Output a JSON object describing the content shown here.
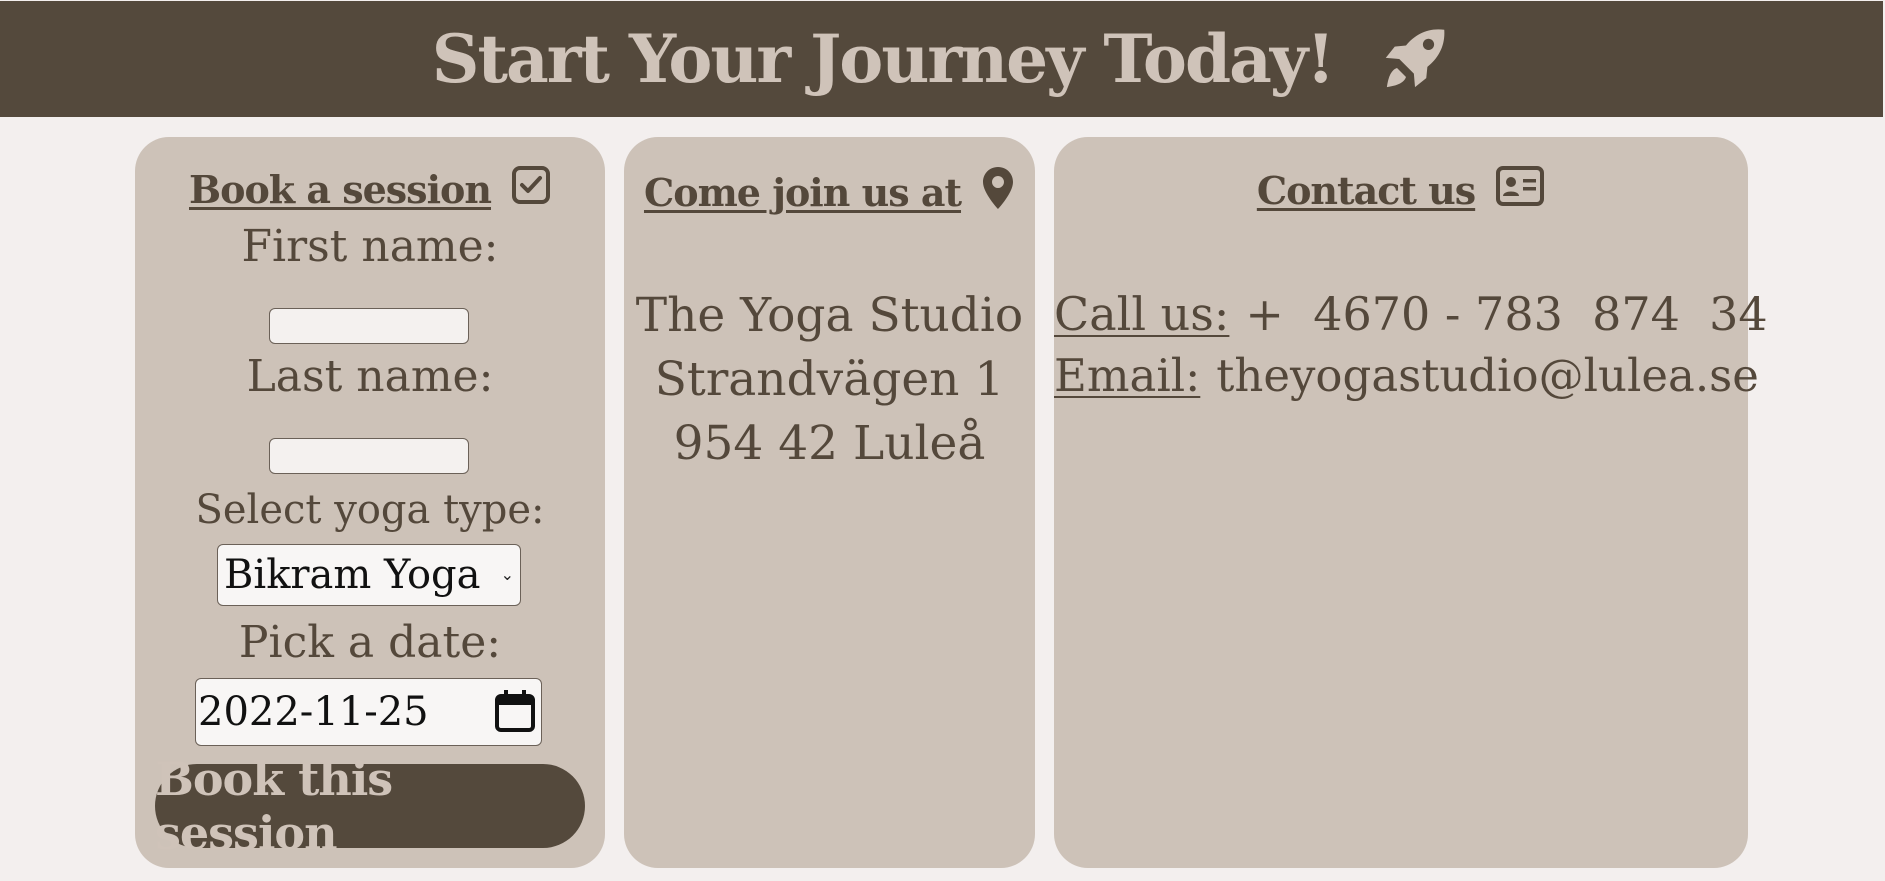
{
  "banner": {
    "title": "Start Your Journey Today!",
    "icon": "rocket-icon",
    "background": "#54493c",
    "text_color": "#cfc3b9"
  },
  "booking": {
    "heading": "Book a session",
    "heading_icon": "checkbox-icon",
    "first_name_label": "First name:",
    "first_name_value": "",
    "last_name_label": "Last name:",
    "last_name_value": "",
    "yoga_type_label": "Select yoga type:",
    "yoga_type_selected": "Bikram Yoga",
    "date_label": "Pick a date:",
    "date_value": "2022-11-25",
    "button_label": "Book this session"
  },
  "location": {
    "heading": "Come join us at",
    "heading_icon": "map-pin-icon",
    "lines": [
      "The Yoga Studio",
      "Strandvägen 1",
      "954 42 Luleå"
    ]
  },
  "contact": {
    "heading": "Contact us",
    "heading_icon": "id-card-icon",
    "phone_label": "Call us:",
    "phone_value": "+  4670 - 783  874  34",
    "email_label": "Email:",
    "email_value": "theyogastudio@lulea.se"
  },
  "colors": {
    "page_background": "#f3efee",
    "card_background": "#cdc2b8",
    "text": "#54483b"
  }
}
